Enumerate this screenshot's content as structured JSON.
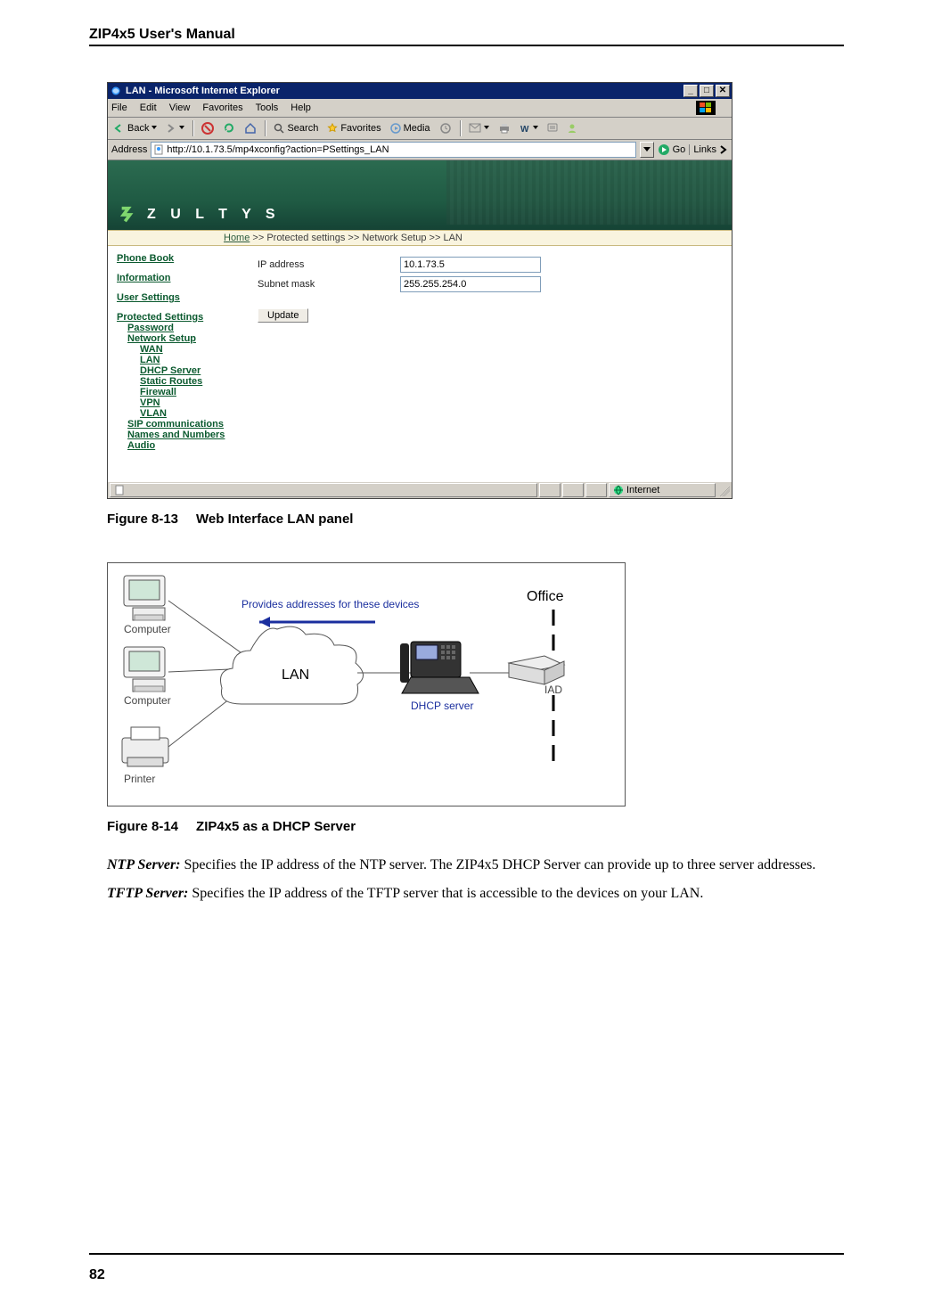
{
  "doc": {
    "running_head": "ZIP4x5 User's Manual",
    "page_number": "82"
  },
  "fig13": {
    "caption_prefix": "Figure 8-13",
    "caption_title": "Web Interface LAN panel"
  },
  "fig14": {
    "caption_prefix": "Figure 8-14",
    "caption_title": "ZIP4x5 as a DHCP Server",
    "labels": {
      "computer": "Computer",
      "printer": "Printer",
      "lan": "LAN",
      "provides": "Provides addresses for these devices",
      "dhcp": "DHCP server",
      "office": "Office",
      "iad": "IAD"
    }
  },
  "ie": {
    "title": "LAN - Microsoft Internet Explorer",
    "menus": {
      "file": "File",
      "edit": "Edit",
      "view": "View",
      "favorites": "Favorites",
      "tools": "Tools",
      "help": "Help"
    },
    "toolbar": {
      "back": "Back",
      "search": "Search",
      "favorites": "Favorites",
      "media": "Media"
    },
    "addressbar": {
      "label": "Address",
      "url": "http://10.1.73.5/mp4xconfig?action=PSettings_LAN",
      "go": "Go",
      "links": "Links"
    },
    "breadcrumb": {
      "home": "Home",
      "sep": " >> ",
      "p1": "Protected settings",
      "p2": "Network Setup",
      "p3": "LAN"
    },
    "nav": {
      "phone_book": "Phone Book",
      "information": "Information",
      "user_settings": "User Settings",
      "protected": "Protected Settings",
      "password": "Password",
      "network_setup": "Network Setup",
      "wan": "WAN",
      "lan": "LAN",
      "dhcp": "DHCP Server",
      "static": "Static Routes",
      "firewall": "Firewall",
      "vpn": "VPN",
      "vlan": "VLAN",
      "sip": "SIP communications",
      "names": "Names and Numbers",
      "audio": "Audio"
    },
    "form": {
      "ip_label": "IP address",
      "ip_value": "10.1.73.5",
      "mask_label": "Subnet mask",
      "mask_value": "255.255.254.0",
      "update": "Update"
    },
    "status": {
      "zone": "Internet"
    },
    "brand": "Z U L T Y S"
  },
  "body": {
    "ntp_term": "NTP Server:",
    "ntp_text": " Specifies the IP address of the NTP server. The ZIP4x5 DHCP Server can provide up to three server addresses.",
    "tftp_term": "TFTP Server:",
    "tftp_text": " Specifies the IP address of the TFTP server that is accessible to the devices on your LAN."
  }
}
